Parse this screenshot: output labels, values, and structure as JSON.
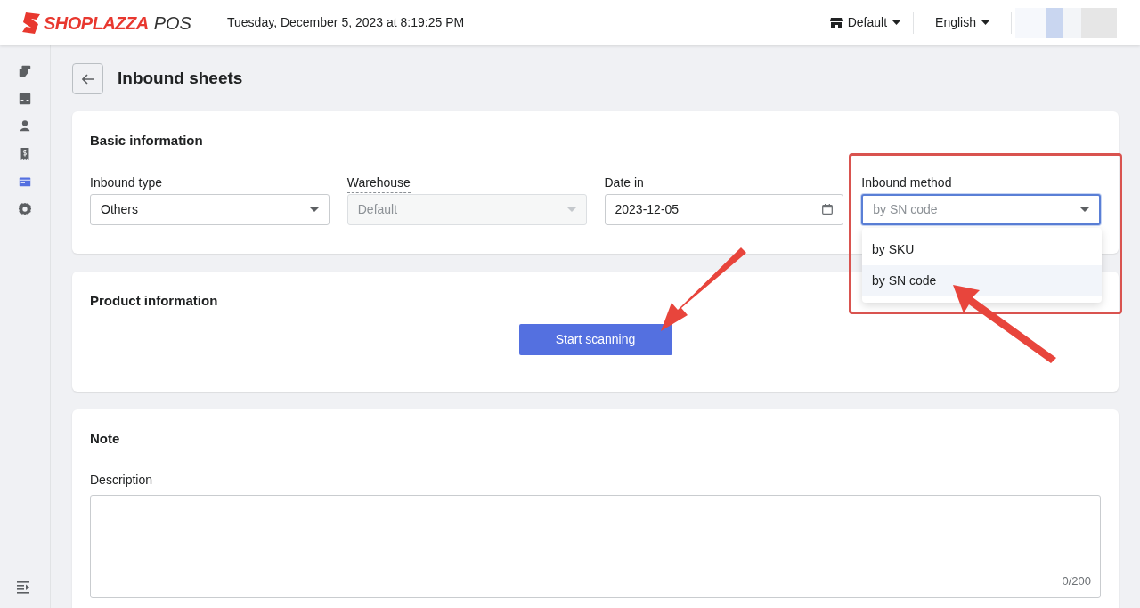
{
  "header": {
    "brand": "SHOPLAZZA",
    "brand_suffix": "POS",
    "datetime": "Tuesday, December 5, 2023 at 8:19:25 PM",
    "store": "Default",
    "language": "English"
  },
  "sidebar": {
    "items": [
      {
        "kind": "cards",
        "selected": false
      },
      {
        "kind": "inbox",
        "selected": false
      },
      {
        "kind": "person",
        "selected": false
      },
      {
        "kind": "receipt",
        "selected": false
      },
      {
        "kind": "box",
        "selected": true
      },
      {
        "kind": "gear",
        "selected": false
      }
    ]
  },
  "page": {
    "title": "Inbound sheets"
  },
  "basic": {
    "title": "Basic information",
    "fields": [
      {
        "label": "Inbound type",
        "kind": "select",
        "value": "Others",
        "disabled": false,
        "focused": false,
        "hint": false
      },
      {
        "label": "Warehouse",
        "kind": "select",
        "placeholder": "Default",
        "disabled": true,
        "focused": false,
        "hint": true
      },
      {
        "label": "Date in",
        "kind": "date",
        "value": "2023-12-05",
        "disabled": false,
        "focused": false,
        "hint": false
      },
      {
        "label": "Inbound method",
        "kind": "select",
        "placeholder": "by SN code",
        "disabled": false,
        "focused": true,
        "hint": false,
        "options": [
          {
            "label": "by SKU",
            "selected": false
          },
          {
            "label": "by SN code",
            "selected": true
          }
        ]
      }
    ]
  },
  "product": {
    "title": "Product information",
    "button": "Start scanning"
  },
  "note": {
    "title": "Note",
    "label": "Description",
    "counter": "0/200"
  }
}
